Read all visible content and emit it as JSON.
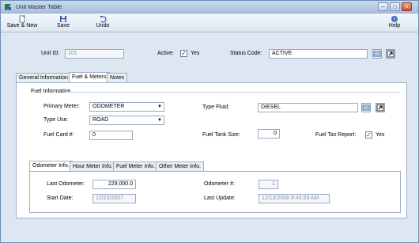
{
  "window": {
    "title": "Unit Master Table"
  },
  "toolbar": {
    "save_new_label": "Save & New",
    "save_label": "Save",
    "undo_label": "Undo",
    "help_label": "Help"
  },
  "header": {
    "unit_id_label": "Unit ID:",
    "unit_id_value": "101",
    "active_label": "Active:",
    "active_checked": true,
    "active_yes": "Yes",
    "status_code_label": "Status Code:",
    "status_code_value": "ACTIVE"
  },
  "main_tabs": [
    {
      "label": "General Information",
      "active": false
    },
    {
      "label": "Fuel & Meters",
      "active": true
    },
    {
      "label": "Notes",
      "active": false
    }
  ],
  "fuel_info": {
    "group_title": "Fuel Information",
    "primary_meter_label": "Primary Meter:",
    "primary_meter_value": "ODOMETER",
    "type_use_label": "Type Use:",
    "type_use_value": "ROAD",
    "fuel_card_label": "Fuel Card #:",
    "fuel_card_value": "0",
    "type_fluid_label": "Type Fluid:",
    "type_fluid_value": "DIESEL",
    "fuel_tank_size_label": "Fuel Tank Size:",
    "fuel_tank_size_value": "0",
    "fuel_tax_report_label": "Fuel Tax Report:",
    "fuel_tax_report_checked": true,
    "fuel_tax_report_yes": "Yes"
  },
  "meter_tabs": [
    {
      "label": "Odometer Info.",
      "active": true
    },
    {
      "label": "Hour Meter Info.",
      "active": false
    },
    {
      "label": "Fuel Meter Info.",
      "active": false
    },
    {
      "label": "Other Meter Info.",
      "active": false
    }
  ],
  "odometer": {
    "last_odometer_label": "Last Odometer:",
    "last_odometer_value": "229,000.0",
    "odometer_num_label": "Odometer #:",
    "odometer_num_value": "1",
    "start_date_label": "Start Date:",
    "start_date_value": "12/23/2007",
    "last_update_label": "Last Update:",
    "last_update_value": "12/13/2008 9:45:59 AM"
  },
  "colors": {
    "window_bg": "#dde6f1",
    "titlebar": "#a9c0df",
    "close_button": "#c9543a"
  }
}
